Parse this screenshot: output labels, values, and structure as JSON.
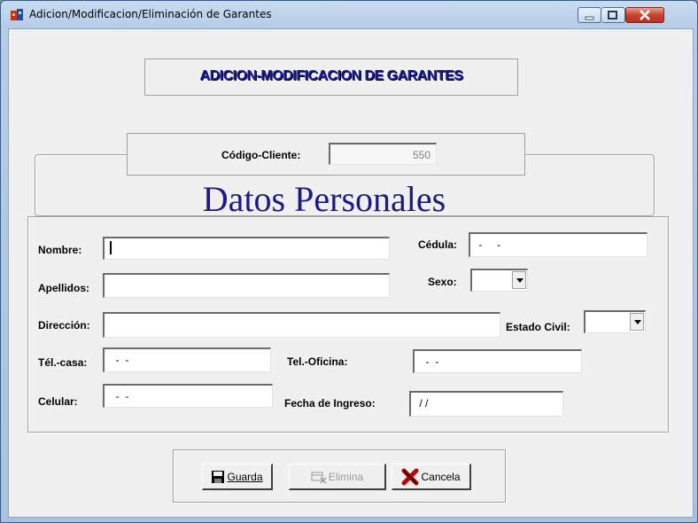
{
  "window": {
    "title": "Adicion/Modificacion/Eliminación de Garantes"
  },
  "banner": {
    "heading": "ADICION-MODIFICACION DE GARANTES"
  },
  "client": {
    "label": "Código-Cliente:",
    "value": "550"
  },
  "section_title": "Datos Personales",
  "fields": {
    "nombre": {
      "label": "Nombre:",
      "value": ""
    },
    "apellidos": {
      "label": "Apellidos:",
      "value": ""
    },
    "cedula": {
      "label": "Cédula:",
      "value": " -     -"
    },
    "sexo": {
      "label": "Sexo:",
      "value": ""
    },
    "direccion": {
      "label": "Dirección:",
      "value": ""
    },
    "estado_civil": {
      "label": "Estado Civil:",
      "value": ""
    },
    "tel_casa": {
      "label": "Tél.-casa:",
      "value": "  -  -"
    },
    "tel_oficina": {
      "label": "Tel.-Oficina:",
      "value": "  -  -"
    },
    "celular": {
      "label": "Celular:",
      "value": "  -  -"
    },
    "fecha_ingreso": {
      "label": "Fecha de Ingreso:",
      "value": " / /"
    }
  },
  "buttons": {
    "guarda": {
      "label": "Guarda",
      "icon": "floppy-disk-icon"
    },
    "elimina": {
      "label": "Elimina",
      "icon": "delete-record-icon"
    },
    "cancela": {
      "label": "Cancela",
      "icon": "red-x-icon"
    }
  },
  "colors": {
    "title_blue": "#1c1a8a",
    "banner_blue": "#1a1aa0",
    "close_red": "#c8432f"
  }
}
